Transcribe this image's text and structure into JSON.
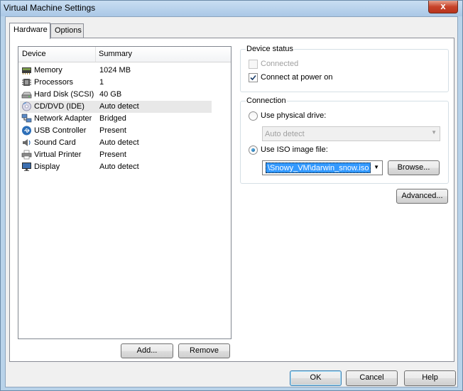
{
  "window": {
    "title": "Virtual Machine Settings",
    "close_glyph": "x"
  },
  "tabs": [
    {
      "label": "Hardware",
      "active": true
    },
    {
      "label": "Options",
      "active": false
    }
  ],
  "device_list": {
    "columns": [
      "Device",
      "Summary"
    ],
    "rows": [
      {
        "device": "Memory",
        "summary": "1024 MB",
        "icon": "memory-icon"
      },
      {
        "device": "Processors",
        "summary": "1",
        "icon": "processor-icon"
      },
      {
        "device": "Hard Disk (SCSI)",
        "summary": "40 GB",
        "icon": "hard-disk-icon"
      },
      {
        "device": "CD/DVD (IDE)",
        "summary": "Auto detect",
        "icon": "cd-dvd-icon",
        "selected": true
      },
      {
        "device": "Network Adapter",
        "summary": "Bridged",
        "icon": "network-adapter-icon"
      },
      {
        "device": "USB Controller",
        "summary": "Present",
        "icon": "usb-icon"
      },
      {
        "device": "Sound Card",
        "summary": "Auto detect",
        "icon": "sound-icon"
      },
      {
        "device": "Virtual Printer",
        "summary": "Present",
        "icon": "printer-icon"
      },
      {
        "device": "Display",
        "summary": "Auto detect",
        "icon": "display-icon"
      }
    ],
    "add_button": "Add...",
    "remove_button": "Remove"
  },
  "device_status": {
    "title": "Device status",
    "connected_label": "Connected",
    "connected_checked": false,
    "connected_disabled": true,
    "connect_power_label": "Connect at power on",
    "connect_power_checked": true
  },
  "connection": {
    "title": "Connection",
    "physical_label": "Use physical drive:",
    "physical_selected": false,
    "physical_value": "Auto detect",
    "iso_label": "Use ISO image file:",
    "iso_selected": true,
    "iso_value": "\\Snowy_VM\\darwin_snow.iso",
    "browse_button": "Browse..."
  },
  "advanced_button": "Advanced...",
  "footer": {
    "ok": "OK",
    "cancel": "Cancel",
    "help": "Help"
  }
}
